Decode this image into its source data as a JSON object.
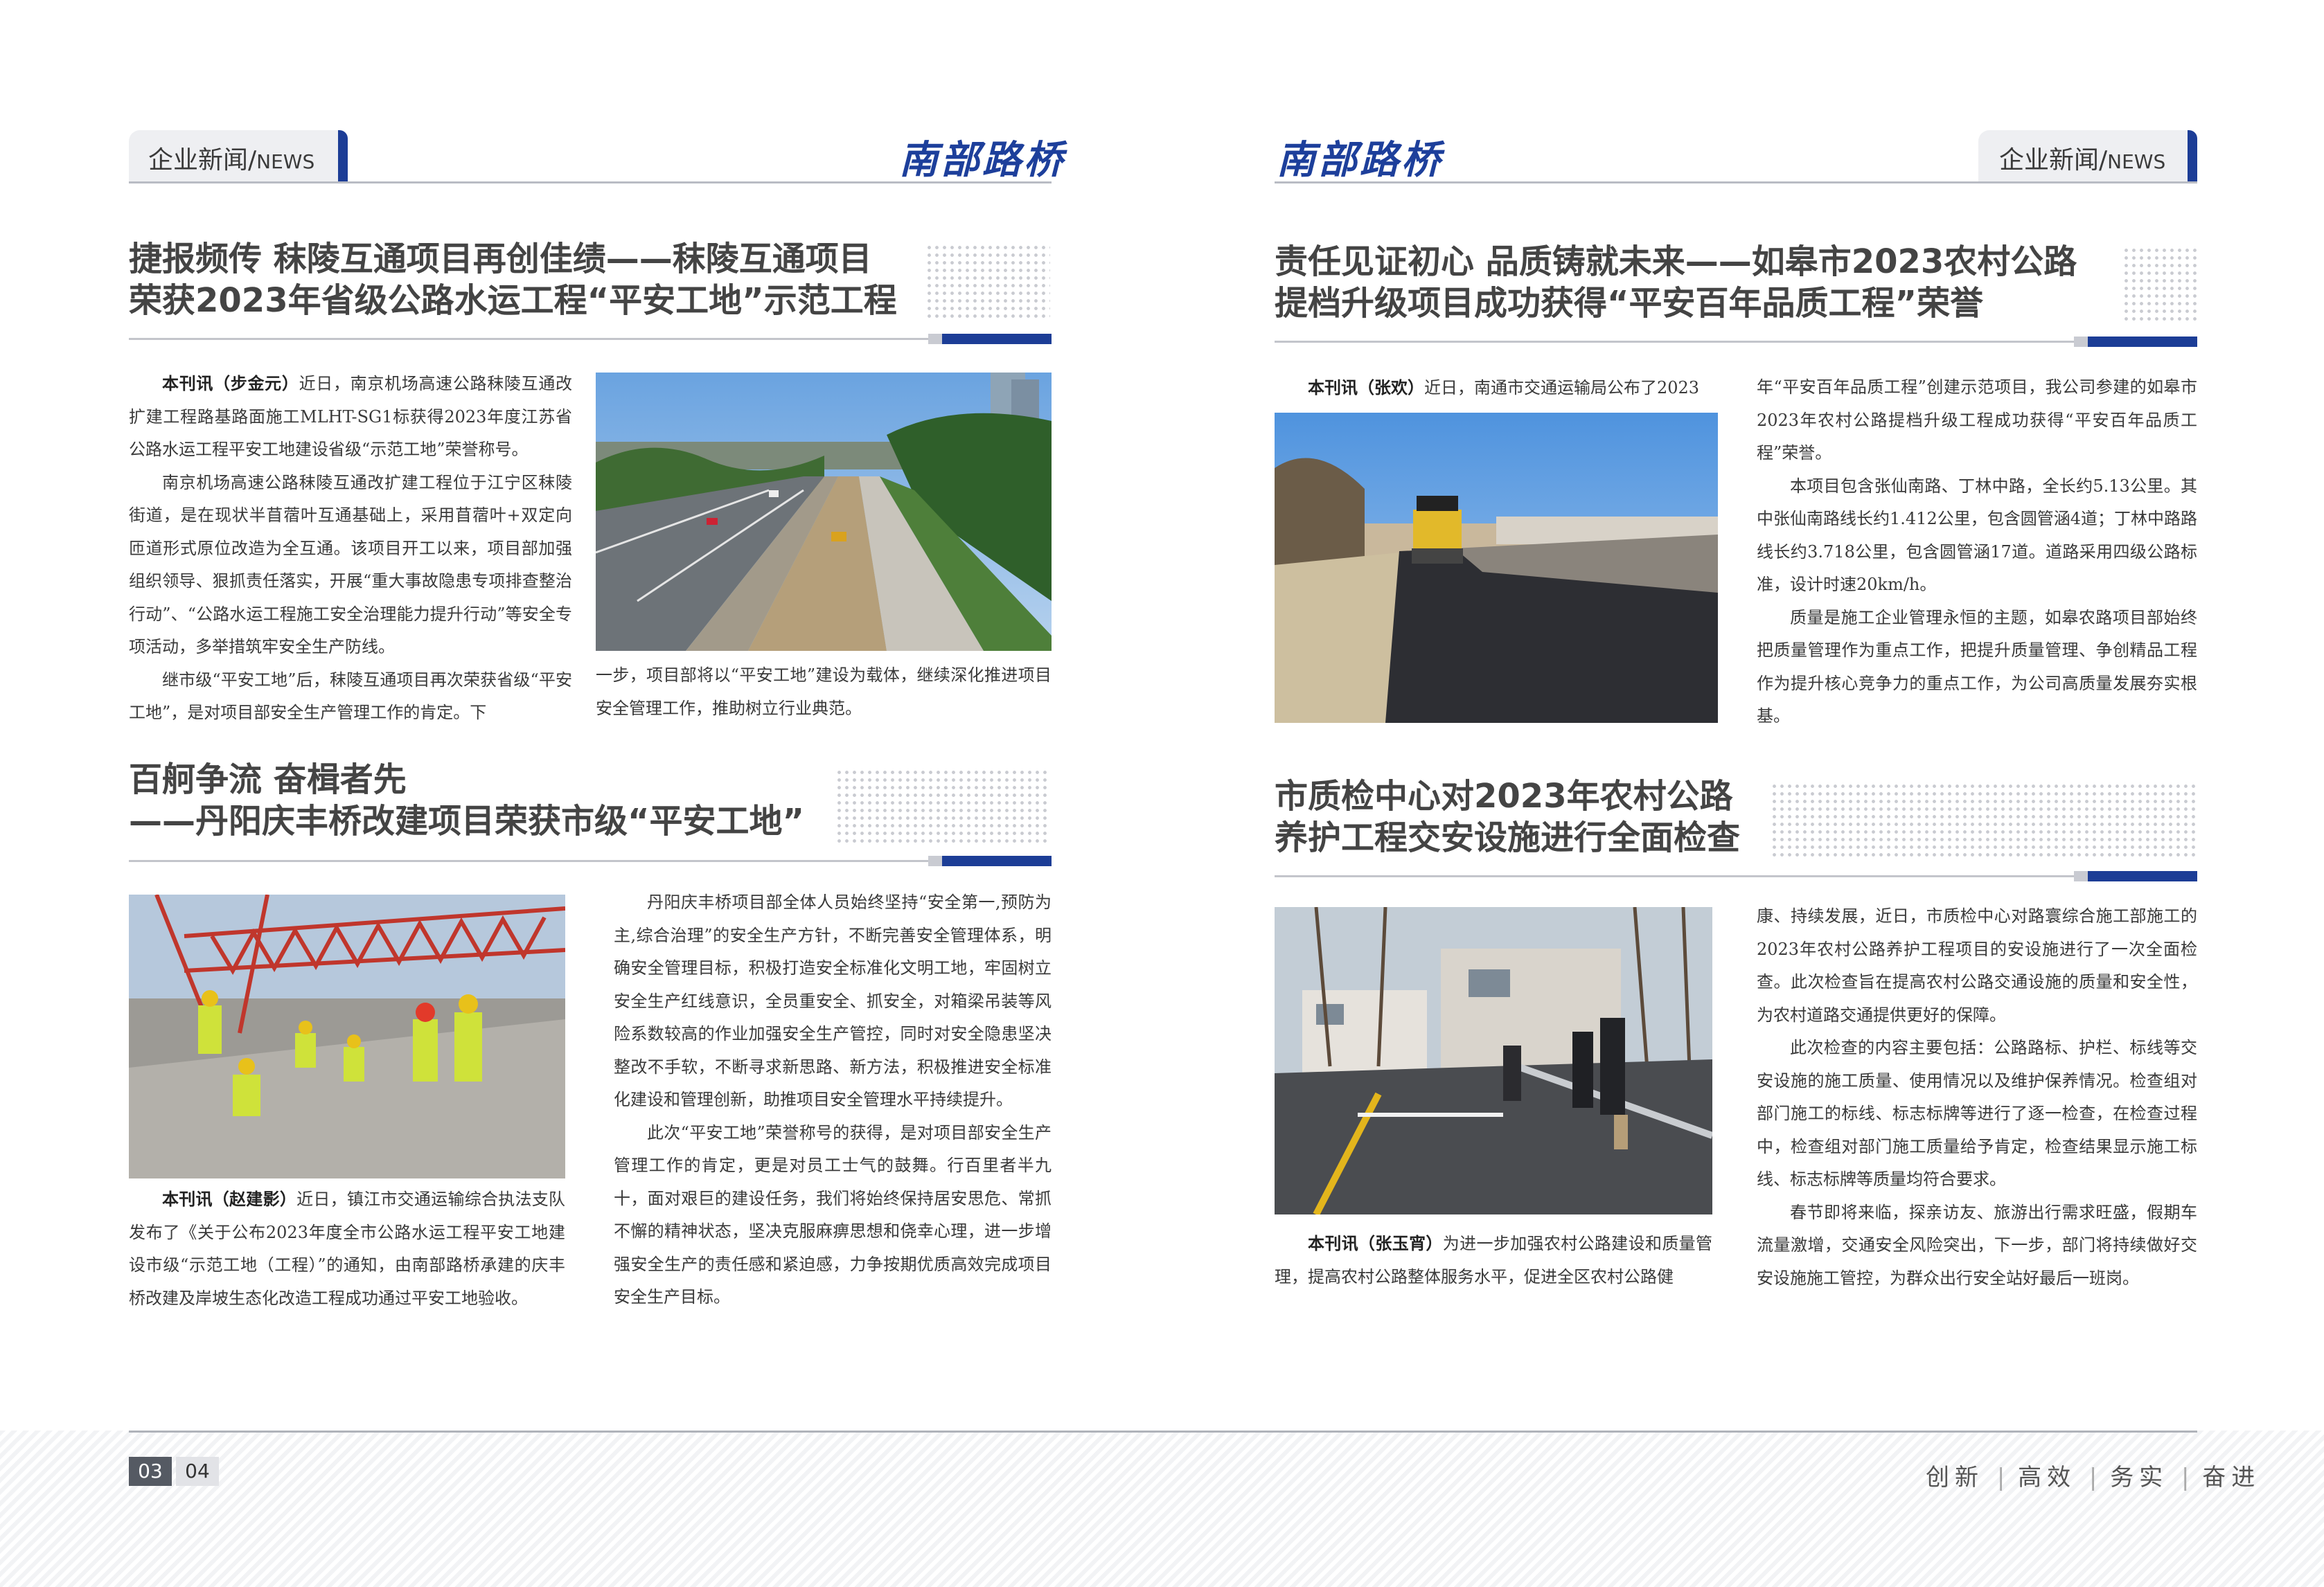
{
  "header": {
    "section_cn": "企业新闻",
    "section_en": "NEWS",
    "section_sep": "/",
    "logo": "南部路桥"
  },
  "left": {
    "article1": {
      "title_line1": "捷报频传 秣陵互通项目再创佳绩——秣陵互通项目",
      "title_line2": "荣获2023年省级公路水运工程“平安工地”示范工程",
      "lead": "本刊讯（步金元）",
      "p1": "近日，南京机场高速公路秣陵互通改扩建工程路基路面施工MLHT-SG1标获得2023年度江苏省公路水运工程平安工地建设省级“示范工地”荣誉称号。",
      "p2": "南京机场高速公路秣陵互通改扩建工程位于江宁区秣陵街道，是在现状半苜蓿叶互通基础上，采用苜蓿叶+双定向匝道形式原位改造为全互通。该项目开工以来，项目部加强组织领导、狠抓责任落实，开展“重大事故隐患专项排查整治行动”、“公路水运工程施工安全治理能力提升行动”等安全专项活动，多举措筑牢安全生产防线。",
      "p3": "继市级“平安工地”后，秣陵互通项目再次荣获省级“平安工地”，是对项目部安全生产管理工作的肯定。下",
      "p3_cont": "一步，项目部将以“平安工地”建设为载体，继续深化推进项目安全管理工作，推助树立行业典范。"
    },
    "article2": {
      "title_line1": "百舸争流 奋楫者先",
      "title_line2": "——丹阳庆丰桥改建项目荣获市级“平安工地”",
      "lead": "本刊讯（赵建影）",
      "p1": "近日，镇江市交通运输综合执法支队发布了《关于公布2023年度全市公路水运工程平安工地建设市级“示范工地（工程）”的通知，由南部路桥承建的庆丰桥改建及岸坡生态化改造工程成功通过平安工地验收。",
      "p2": "丹阳庆丰桥项目部全体人员始终坚持“安全第一,预防为主,综合治理”的安全生产方针，不断完善安全管理体系，明确安全管理目标，积极打造安全标准化文明工地，牢固树立安全生产红线意识，全员重安全、抓安全，对箱梁吊装等风险系数较高的作业加强安全生产管控，同时对安全隐患坚决整改不手软，不断寻求新思路、新方法，积极推进安全标准化建设和管理创新，助推项目安全管理水平持续提升。",
      "p3": "此次“平安工地”荣誉称号的获得，是对项目部安全生产管理工作的肯定，更是对员工士气的鼓舞。行百里者半九十，面对艰巨的建设任务，我们将始终保持居安思危、常抓不懈的精神状态，坚决克服麻痹思想和侥幸心理，进一步增强安全生产的责任感和紧迫感，力争按期优质高效完成项目安全生产目标。"
    }
  },
  "right": {
    "article1": {
      "title_line1": "责任见证初心 品质铸就未来——如皋市2023农村公路",
      "title_line2": "提档升级项目成功获得“平安百年品质工程”荣誉",
      "lead": "本刊讯（张欢）",
      "p1": "近日，南通市交通运输局公布了2023",
      "p1_cont": "年“平安百年品质工程”创建示范项目，我公司参建的如皋市2023年农村公路提档升级工程成功获得“平安百年品质工程”荣誉。",
      "p2": "本项目包含张仙南路、丁林中路，全长约5.13公里。其中张仙南路线长约1.412公里，包含圆管涵4道；丁林中路路线长约3.718公里，包含圆管涵17道。道路采用四级公路标准，设计时速20km/h。",
      "p3": "质量是施工企业管理永恒的主题，如皋农路项目部始终把质量管理作为重点工作，把提升质量管理、争创精品工程作为提升核心竞争力的重点工作，为公司高质量发展夯实根基。"
    },
    "article2": {
      "title_line1": "市质检中心对2023年农村公路",
      "title_line2": "养护工程交安设施进行全面检查",
      "lead": "本刊讯（张玉宵）",
      "p1": "为进一步加强农村公路建设和质量管理，提高农村公路整体服务水平，促进全区农村公路健",
      "p1_cont": "康、持续发展，近日，市质检中心对路寰综合施工部施工的2023年农村公路养护工程项目的安设施进行了一次全面检查。此次检查旨在提高农村公路交通设施的质量和安全性，为农村道路交通提供更好的保障。",
      "p2": "此次检查的内容主要包括：公路路标、护栏、标线等交安设施的施工质量、使用情况以及维护保养情况。检查组对部门施工的标线、标志标牌等进行了逐一检查，在检查过程中，检查组对部门施工质量给予肯定，检查结果显示施工标线、标志标牌等质量均符合要求。",
      "p3": "春节即将来临，探亲访友、旅游出行需求旺盛，假期车流量激增，交通安全风险突出，下一步，部门将持续做好交安设施施工管控，为群众出行安全站好最后一班岗。"
    }
  },
  "footer": {
    "page_left": "03",
    "page_right": "04",
    "slogan": [
      "创新",
      "高效",
      "务实",
      "奋进"
    ],
    "slogan_sep": "|"
  },
  "colors": {
    "brand_blue": "#1c3d96",
    "heading_gray": "#444444"
  }
}
